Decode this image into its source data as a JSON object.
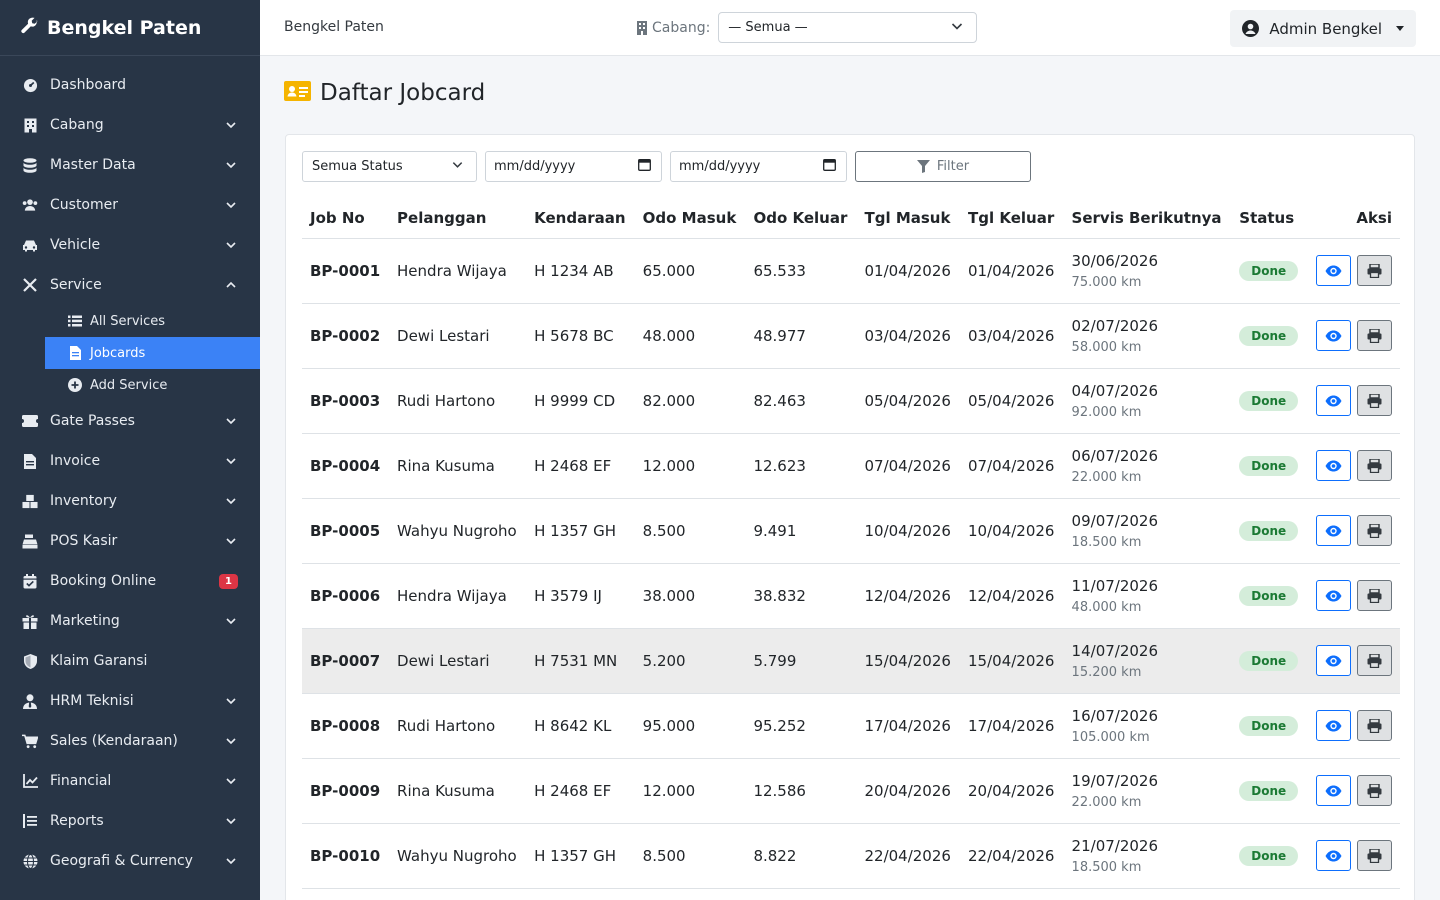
{
  "brand": "Bengkel Paten",
  "sidebar": {
    "items": [
      {
        "label": "Dashboard",
        "icon": "dashboard-icon"
      },
      {
        "label": "Cabang",
        "icon": "building-icon"
      },
      {
        "label": "Master Data",
        "icon": "database-icon"
      },
      {
        "label": "Customer",
        "icon": "users-icon"
      },
      {
        "label": "Vehicle",
        "icon": "car-icon"
      },
      {
        "label": "Service",
        "icon": "tools-icon"
      },
      {
        "label": "Gate Passes",
        "icon": "ticket-icon"
      },
      {
        "label": "Invoice",
        "icon": "file-invoice-icon"
      },
      {
        "label": "Inventory",
        "icon": "boxes-icon"
      },
      {
        "label": "POS Kasir",
        "icon": "cash-register-icon"
      },
      {
        "label": "Booking Online",
        "icon": "calendar-check-icon",
        "badge": "1"
      },
      {
        "label": "Marketing",
        "icon": "gift-icon"
      },
      {
        "label": "Klaim Garansi",
        "icon": "shield-icon"
      },
      {
        "label": "HRM Teknisi",
        "icon": "user-tie-icon"
      },
      {
        "label": "Sales (Kendaraan)",
        "icon": "cart-icon"
      },
      {
        "label": "Financial",
        "icon": "chart-line-icon"
      },
      {
        "label": "Reports",
        "icon": "list-alt-icon"
      },
      {
        "label": "Geografi & Currency",
        "icon": "globe-icon"
      }
    ],
    "service_sub": [
      {
        "label": "All Services",
        "icon": "list-icon"
      },
      {
        "label": "Jobcards",
        "icon": "file-icon"
      },
      {
        "label": "Add Service",
        "icon": "plus-circle-icon"
      }
    ]
  },
  "topbar": {
    "title": "Bengkel Paten",
    "cabang_label": "Cabang:",
    "cabang_value": "— Semua —",
    "user": "Admin Bengkel"
  },
  "page": {
    "title": "Daftar Jobcard"
  },
  "filters": {
    "status": "Semua Status",
    "date_from": "mm/dd/yyyy",
    "date_to": "mm/dd/yyyy",
    "button": "Filter"
  },
  "table": {
    "headers": [
      "Job No",
      "Pelanggan",
      "Kendaraan",
      "Odo Masuk",
      "Odo Keluar",
      "Tgl Masuk",
      "Tgl Keluar",
      "Servis Berikutnya",
      "Status",
      "Aksi"
    ],
    "rows": [
      {
        "job": "BP-0001",
        "pelanggan": "Hendra Wijaya",
        "kendaraan": "H 1234 AB",
        "odo_in": "65.000",
        "odo_out": "65.533",
        "tgl_in": "01/04/2026",
        "tgl_out": "01/04/2026",
        "next_date": "30/06/2026",
        "next_km": "75.000 km",
        "status": "Done"
      },
      {
        "job": "BP-0002",
        "pelanggan": "Dewi Lestari",
        "kendaraan": "H 5678 BC",
        "odo_in": "48.000",
        "odo_out": "48.977",
        "tgl_in": "03/04/2026",
        "tgl_out": "03/04/2026",
        "next_date": "02/07/2026",
        "next_km": "58.000 km",
        "status": "Done"
      },
      {
        "job": "BP-0003",
        "pelanggan": "Rudi Hartono",
        "kendaraan": "H 9999 CD",
        "odo_in": "82.000",
        "odo_out": "82.463",
        "tgl_in": "05/04/2026",
        "tgl_out": "05/04/2026",
        "next_date": "04/07/2026",
        "next_km": "92.000 km",
        "status": "Done"
      },
      {
        "job": "BP-0004",
        "pelanggan": "Rina Kusuma",
        "kendaraan": "H 2468 EF",
        "odo_in": "12.000",
        "odo_out": "12.623",
        "tgl_in": "07/04/2026",
        "tgl_out": "07/04/2026",
        "next_date": "06/07/2026",
        "next_km": "22.000 km",
        "status": "Done"
      },
      {
        "job": "BP-0005",
        "pelanggan": "Wahyu Nugroho",
        "kendaraan": "H 1357 GH",
        "odo_in": "8.500",
        "odo_out": "9.491",
        "tgl_in": "10/04/2026",
        "tgl_out": "10/04/2026",
        "next_date": "09/07/2026",
        "next_km": "18.500 km",
        "status": "Done"
      },
      {
        "job": "BP-0006",
        "pelanggan": "Hendra Wijaya",
        "kendaraan": "H 3579 IJ",
        "odo_in": "38.000",
        "odo_out": "38.832",
        "tgl_in": "12/04/2026",
        "tgl_out": "12/04/2026",
        "next_date": "11/07/2026",
        "next_km": "48.000 km",
        "status": "Done"
      },
      {
        "job": "BP-0007",
        "pelanggan": "Dewi Lestari",
        "kendaraan": "H 7531 MN",
        "odo_in": "5.200",
        "odo_out": "5.799",
        "tgl_in": "15/04/2026",
        "tgl_out": "15/04/2026",
        "next_date": "14/07/2026",
        "next_km": "15.200 km",
        "status": "Done"
      },
      {
        "job": "BP-0008",
        "pelanggan": "Rudi Hartono",
        "kendaraan": "H 8642 KL",
        "odo_in": "95.000",
        "odo_out": "95.252",
        "tgl_in": "17/04/2026",
        "tgl_out": "17/04/2026",
        "next_date": "16/07/2026",
        "next_km": "105.000 km",
        "status": "Done"
      },
      {
        "job": "BP-0009",
        "pelanggan": "Rina Kusuma",
        "kendaraan": "H 2468 EF",
        "odo_in": "12.000",
        "odo_out": "12.586",
        "tgl_in": "20/04/2026",
        "tgl_out": "20/04/2026",
        "next_date": "19/07/2026",
        "next_km": "22.000 km",
        "status": "Done"
      },
      {
        "job": "BP-0010",
        "pelanggan": "Wahyu Nugroho",
        "kendaraan": "H 1357 GH",
        "odo_in": "8.500",
        "odo_out": "8.822",
        "tgl_in": "22/04/2026",
        "tgl_out": "22/04/2026",
        "next_date": "21/07/2026",
        "next_km": "18.500 km",
        "status": "Done"
      }
    ]
  },
  "colors": {
    "sidebar_bg": "#283546",
    "active_item": "#3b82f6",
    "badge": "#dc3545",
    "status_done_bg": "#d4edda",
    "status_done_text": "#1b7a34",
    "view_button": "#0d6efd",
    "page_icon": "#f5b400"
  }
}
